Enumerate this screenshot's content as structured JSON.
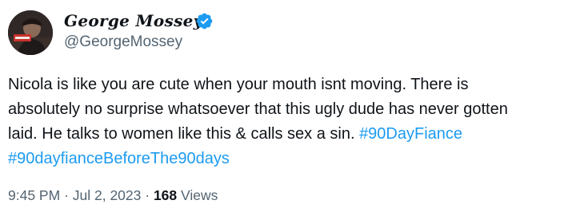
{
  "author": {
    "display_name": "George Mossey",
    "handle": "@GeorgeMossey",
    "verified": true,
    "avatar_icon": "profile-photo-icon"
  },
  "tweet": {
    "line1": "Nicola is like you are cute when your mouth isnt moving. There is",
    "line2": "absolutely no surprise whatsoever that this ugly dude has never gotten",
    "line3_text": "laid. He talks to women like this & calls sex a sin. ",
    "hashtag1": "#90DayFiance",
    "hashtag2": "#90dayfianceBeforeThe90days"
  },
  "meta": {
    "time": "9:45 PM",
    "separator": " · ",
    "date": "Jul 2, 2023",
    "views_count": "168",
    "views_label": " Views"
  },
  "colors": {
    "link": "#1d9bf0",
    "secondary_text": "#536471",
    "primary_text": "#0f1419",
    "verified_badge": "#1d9bf0"
  }
}
